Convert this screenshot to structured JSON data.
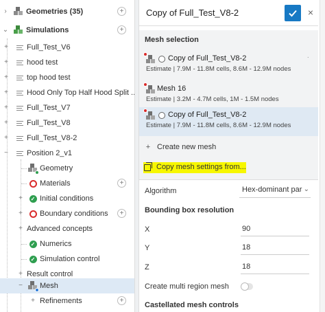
{
  "tree": {
    "rows": [
      {
        "label": "Geometries (35)",
        "icon": "cubes-icon"
      },
      {
        "label": "Simulations",
        "icon": "simulation-cubes-icon"
      },
      {
        "label": "Full_Test_V6",
        "icon": "simulation-list-icon"
      },
      {
        "label": "hood test",
        "icon": "simulation-list-icon"
      },
      {
        "label": "top hood test",
        "icon": "simulation-list-icon"
      },
      {
        "label": "Hood Only Top Half Hood Split ...",
        "icon": "simulation-list-icon"
      },
      {
        "label": "Full_Test_V7",
        "icon": "simulation-list-icon"
      },
      {
        "label": "Full_Test_V8",
        "icon": "simulation-list-icon"
      },
      {
        "label": "Full_Test_V8-2",
        "icon": "simulation-list-icon"
      },
      {
        "label": "Position 2_v1",
        "icon": "simulation-list-icon"
      },
      {
        "label": "Geometry",
        "icon": "geometry-ok-icon"
      },
      {
        "label": "Materials",
        "icon": "error-circle-icon"
      },
      {
        "label": "Initial conditions",
        "icon": "check-circle-icon"
      },
      {
        "label": "Boundary conditions",
        "icon": "error-circle-icon"
      },
      {
        "label": "Advanced concepts",
        "icon": ""
      },
      {
        "label": "Numerics",
        "icon": "check-circle-icon"
      },
      {
        "label": "Simulation control",
        "icon": "check-circle-icon"
      },
      {
        "label": "Result control",
        "icon": ""
      },
      {
        "label": "Mesh",
        "icon": "mesh-icon"
      },
      {
        "label": "Refinements",
        "icon": ""
      }
    ]
  },
  "panel": {
    "title": "Copy of Full_Test_V8-2",
    "confirm_icon": "check-icon",
    "close_icon": "close-icon",
    "mesh_selection_title": "Mesh selection",
    "meshes": [
      {
        "name": "Copy of Full_Test_V8-2",
        "estimate": "Estimate | 7.9M - 11.8M cells, 8.6M - 12.9M nodes"
      },
      {
        "name": "Mesh 16",
        "estimate": "Estimate | 3.2M - 4.7M cells, 1M - 1.5M nodes"
      },
      {
        "name": "Copy of Full_Test_V8-2",
        "estimate": "Estimate | 7.9M - 11.8M cells, 8.6M - 12.9M nodes"
      }
    ],
    "create_new_mesh": "Create new mesh",
    "copy_mesh_settings": "Copy mesh settings from...",
    "algorithm_label": "Algorithm",
    "algorithm_value": "Hex-dominant parametric",
    "bbox_title": "Bounding box resolution",
    "x_label": "X",
    "x_value": "90",
    "y_label": "Y",
    "y_value": "18",
    "z_label": "Z",
    "z_value": "18",
    "multi_region_label": "Create multi region mesh",
    "multi_region_on": false,
    "castellated_title": "Castellated mesh controls"
  },
  "colors": {
    "accent": "#1779c4",
    "highlight": "#f7f700",
    "ok": "#2e9e4f",
    "error": "#d92b2b",
    "selected_bg": "#dde9f5"
  }
}
